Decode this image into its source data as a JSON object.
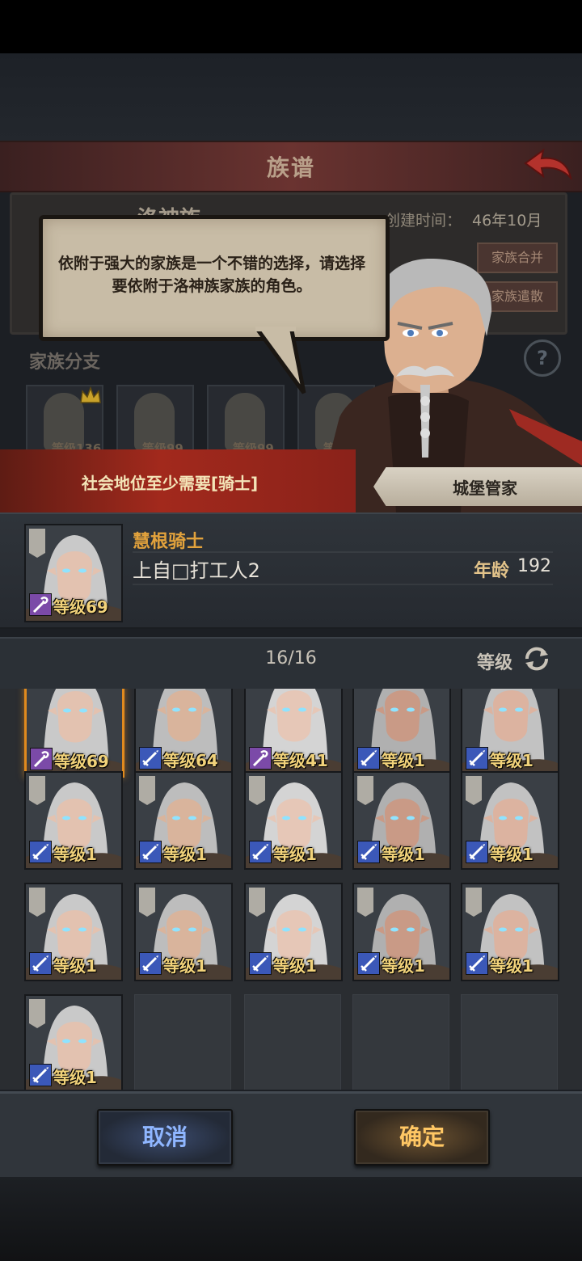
{
  "header": {
    "title": "族谱"
  },
  "family": {
    "name_partial": "洛神族",
    "created_label": "创建时间：",
    "created_value": "46年10月",
    "merge_label": "家族合并",
    "dissolve_label": "家族遣散",
    "branch_title": "家族分支",
    "help_glyph": "?",
    "branch_cards": [
      {
        "level": "等级136"
      },
      {
        "level": "等级99"
      },
      {
        "level": "等级99"
      },
      {
        "level": "等级99"
      }
    ]
  },
  "dialog": {
    "text": "依附于强大的家族是一个不错的选择，请选择要依附于洛神族家族的角色。",
    "requirement": "社会地位至少需要[骑士]",
    "npc_name": "城堡管家"
  },
  "selected": {
    "title": "慧根骑士",
    "name": "上自□打工人2",
    "age_label": "年龄",
    "age": "192",
    "level": "等级69",
    "weapon": "staff"
  },
  "list": {
    "count": "16/16",
    "sort_label": "等级"
  },
  "characters": [
    {
      "level": "等级69",
      "weapon": "staff",
      "selected": true
    },
    {
      "level": "等级64",
      "weapon": "sword"
    },
    {
      "level": "等级41",
      "weapon": "staff"
    },
    {
      "level": "等级1",
      "weapon": "sword"
    },
    {
      "level": "等级1",
      "weapon": "sword"
    },
    {
      "level": "等级1",
      "weapon": "sword"
    },
    {
      "level": "等级1",
      "weapon": "sword"
    },
    {
      "level": "等级1",
      "weapon": "sword"
    },
    {
      "level": "等级1",
      "weapon": "sword"
    },
    {
      "level": "等级1",
      "weapon": "sword"
    },
    {
      "level": "等级1",
      "weapon": "sword"
    },
    {
      "level": "等级1",
      "weapon": "sword"
    },
    {
      "level": "等级1",
      "weapon": "sword"
    },
    {
      "level": "等级1",
      "weapon": "sword"
    },
    {
      "level": "等级1",
      "weapon": "sword"
    },
    {
      "level": "等级1",
      "weapon": "sword"
    }
  ],
  "buttons": {
    "cancel": "取消",
    "confirm": "确定"
  },
  "colors": {
    "staff_badge": "#7b4aa8",
    "sword_badge": "#3b58b8",
    "level_text": "#f1d27a",
    "selected_border": "#e08a1e"
  }
}
